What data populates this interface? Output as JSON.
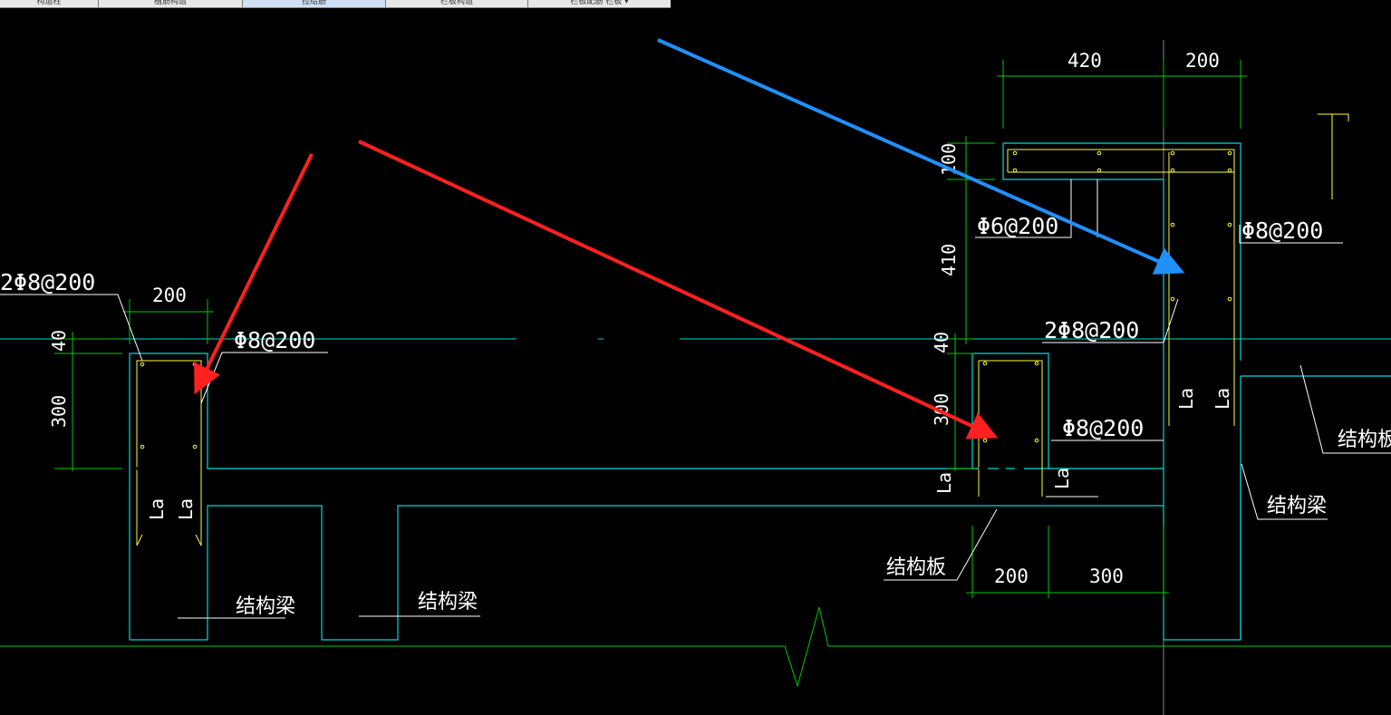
{
  "tabs": [
    {
      "label": "构造柱"
    },
    {
      "label": "植筋构造"
    },
    {
      "label": "拉结筋"
    },
    {
      "label": "栏板构造"
    },
    {
      "label": "栏板配筋 栏板 ▾"
    }
  ],
  "colors": {
    "background": "#000000",
    "outline": "#00d8d8",
    "dimension": "#00c800",
    "text": "#ffffff",
    "rebar": "#ffff33",
    "arrow_red": "#ff2020",
    "arrow_blue": "#2090ff"
  },
  "dims": {
    "w420": "420",
    "w200_top": "200",
    "h100": "100",
    "h410": "410",
    "h40_right": "40",
    "h300_right": "300",
    "w200_bottom": "200",
    "w300_bottom": "300",
    "w200_left": "200",
    "h40_left": "40",
    "h300_left": "300"
  },
  "rebar_labels": {
    "left_2phi8": "2Φ8@200",
    "left_phi8": "Φ8@200",
    "right_phi6": "Φ6@200",
    "right_phi8_vertical": "Φ8@200",
    "right_2phi8": "2Φ8@200",
    "right_phi8": "Φ8@200"
  },
  "anchors": {
    "la": "La"
  },
  "structure_labels": {
    "beam_left": "结构梁",
    "beam_middle": "结构梁",
    "slab_bottom": "结构板",
    "beam_right": "结构梁",
    "slab_right": "结构板"
  }
}
